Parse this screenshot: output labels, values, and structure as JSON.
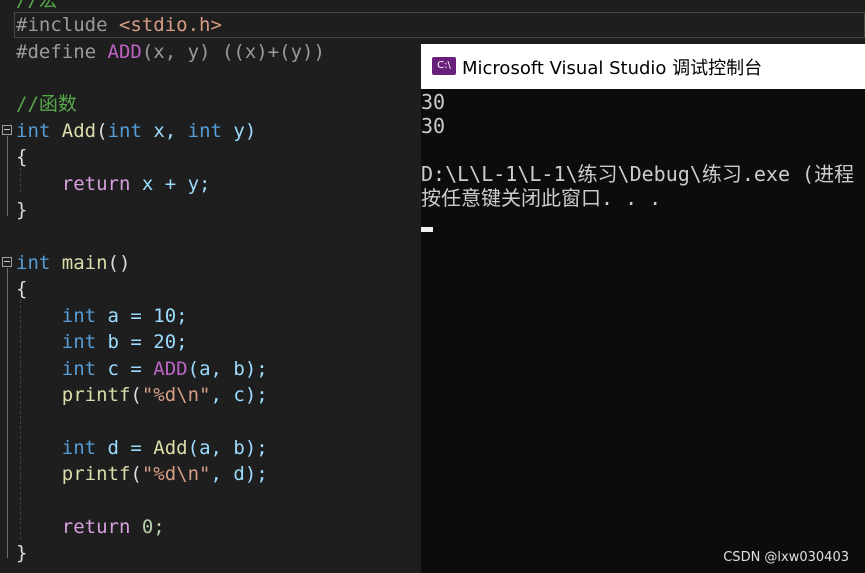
{
  "editor": {
    "lines": {
      "comment_macro": "//宏",
      "include_directive": "#include",
      "include_header": "<stdio.h>",
      "define_directive": "#define",
      "define_name": "ADD",
      "define_params": "(x, y)",
      "define_body": "((x)+(y))",
      "comment_func": "//函数",
      "kw_int": "int",
      "add_name": "Add",
      "add_params_open": "(",
      "add_param_x": "int",
      "add_x": " x, ",
      "add_param_y": "int",
      "add_y": " y)",
      "brace_open": "{",
      "brace_close": "}",
      "return_kw": "return",
      "return_expr": " x + y;",
      "main_name": "main",
      "main_parens": "()",
      "a_decl": " a = 10;",
      "b_decl": " b = 20;",
      "c_decl_pre": " c = ",
      "c_decl_call": "ADD",
      "c_decl_args": "(a, b);",
      "printf": "printf",
      "printf_open": "(",
      "printf_fmt": "\"%d\\n\"",
      "printf_c": ", c);",
      "d_decl_pre": " d = ",
      "d_decl_call": "Add",
      "d_decl_args": "(a, b);",
      "printf_d": ", d);",
      "return0": " 0;"
    }
  },
  "console": {
    "icon_text": "C:\\",
    "title": "Microsoft Visual Studio 调试控制台",
    "output": [
      "30",
      "30",
      "",
      "D:\\L\\L-1\\L-1\\练习\\Debug\\练习.exe (进程",
      "按任意键关闭此窗口. . ."
    ]
  },
  "watermark": "CSDN @lxw030403"
}
